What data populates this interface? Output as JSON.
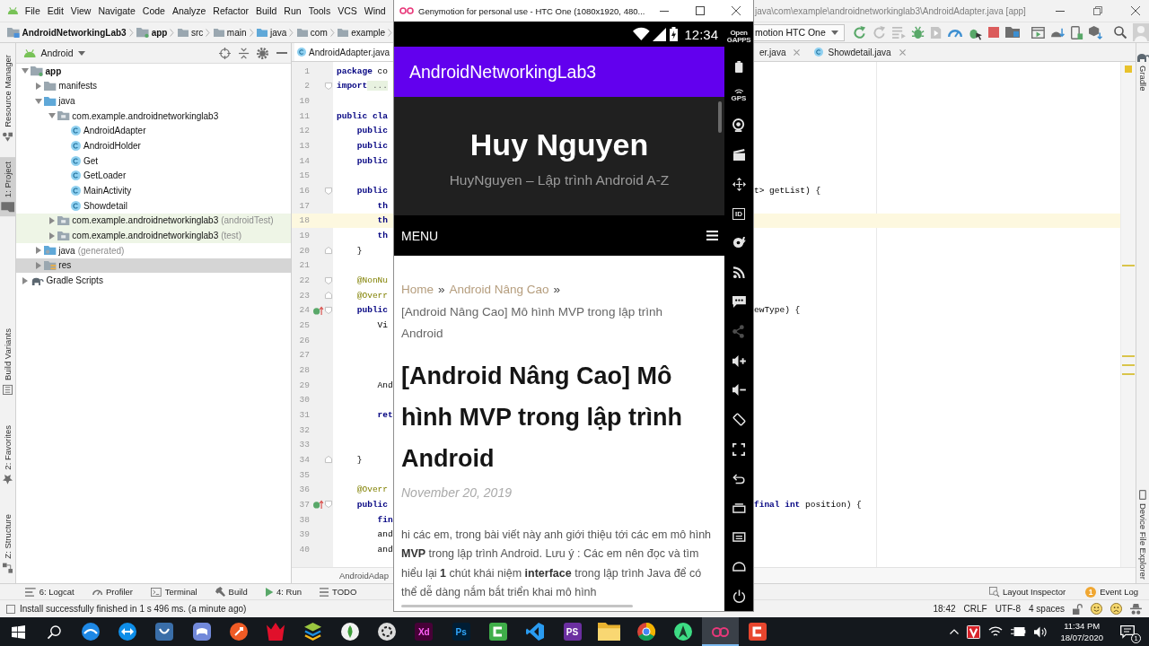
{
  "ide": {
    "menu": [
      "File",
      "Edit",
      "View",
      "Navigate",
      "Code",
      "Analyze",
      "Refactor",
      "Build",
      "Run",
      "Tools",
      "VCS",
      "Wind"
    ],
    "title": "java\\com\\example\\androidnetworkinglab3\\AndroidAdapter.java [app]",
    "breadcrumb": [
      {
        "label": "AndroidNetworkingLab3",
        "kind": "project"
      },
      {
        "label": "app",
        "kind": "module"
      },
      {
        "label": "src",
        "kind": "folder"
      },
      {
        "label": "main",
        "kind": "folder"
      },
      {
        "label": "java",
        "kind": "source"
      },
      {
        "label": "com",
        "kind": "folder"
      },
      {
        "label": "example",
        "kind": "folder"
      }
    ],
    "device": "motion HTC One",
    "left_tools_top": [
      {
        "label": "Resource Manager",
        "kind": "resources",
        "selected": false
      },
      {
        "label": "1: Project",
        "kind": "project",
        "selected": true
      }
    ],
    "left_tools_bottom": [
      {
        "label": "Build Variants",
        "kind": "variants",
        "selected": false
      },
      {
        "label": "2: Favorites",
        "kind": "favorites",
        "selected": false
      },
      {
        "label": "Z: Structure",
        "kind": "structure",
        "selected": false
      }
    ],
    "project": {
      "view": "Android",
      "tree": [
        {
          "label": "app",
          "kind": "module",
          "expanded": true,
          "selected": false,
          "children": [
            {
              "label": "manifests",
              "kind": "folder",
              "expanded": false,
              "selected": false
            },
            {
              "label": "java",
              "kind": "source",
              "expanded": true,
              "selected": false,
              "children": [
                {
                  "label": "com.example.androidnetworkinglab3",
                  "kind": "package",
                  "expanded": true,
                  "selected": false,
                  "children": [
                    {
                      "label": "AndroidAdapter",
                      "kind": "class",
                      "selected": false
                    },
                    {
                      "label": "AndroidHolder",
                      "kind": "class",
                      "selected": false
                    },
                    {
                      "label": "Get",
                      "kind": "class",
                      "selected": false
                    },
                    {
                      "label": "GetLoader",
                      "kind": "class",
                      "selected": false
                    },
                    {
                      "label": "MainActivity",
                      "kind": "class",
                      "selected": false
                    },
                    {
                      "label": "Showdetail",
                      "kind": "class",
                      "selected": false
                    }
                  ]
                },
                {
                  "label": "com.example.androidnetworkinglab3",
                  "note": "(androidTest)",
                  "kind": "test_package",
                  "expanded": false,
                  "selected": false
                },
                {
                  "label": "com.example.androidnetworkinglab3",
                  "note": "(test)",
                  "kind": "test_package",
                  "expanded": false,
                  "selected": false
                }
              ]
            },
            {
              "label": "java",
              "note": "(generated)",
              "kind": "generated",
              "expanded": false,
              "selected": false
            },
            {
              "label": "res",
              "kind": "resources",
              "expanded": false,
              "selected": true
            }
          ]
        },
        {
          "label": "Gradle Scripts",
          "kind": "gradle",
          "expanded": false,
          "selected": false
        }
      ]
    },
    "editor": {
      "tabs_left": [
        {
          "label": "AndroidAdapter.java",
          "kind": "file",
          "selected": true
        }
      ],
      "tabs_right": [
        {
          "label": "er.java",
          "kind": "cut",
          "selected": false,
          "closable": true
        },
        {
          "label": "Showdetail.java",
          "kind": "file",
          "selected": false,
          "closable": true
        }
      ],
      "lines": [
        {
          "number": "1",
          "left": [
            {
              "text": "package",
              "kind": "keyword"
            },
            {
              "text": " co",
              "kind": "plain"
            }
          ],
          "current": false,
          "override": false,
          "fold_open": false,
          "fold_close": false
        },
        {
          "number": "2",
          "left": [
            {
              "text": "import",
              "kind": "keyword"
            },
            {
              "text": " ...",
              "kind": "folded"
            }
          ],
          "current": false,
          "override": false,
          "fold_open": true,
          "fold_close": false
        },
        {
          "number": "10",
          "current": false,
          "override": false,
          "fold_open": false,
          "fold_close": false
        },
        {
          "number": "11",
          "left": [
            {
              "text": "public cla",
              "kind": "keyword"
            }
          ],
          "current": false,
          "override": false,
          "fold_open": false,
          "fold_close": false
        },
        {
          "number": "12",
          "left": [
            {
              "text": "    public",
              "kind": "keyword"
            }
          ],
          "current": false,
          "override": false,
          "fold_open": false,
          "fold_close": false
        },
        {
          "number": "13",
          "left": [
            {
              "text": "    public",
              "kind": "keyword"
            }
          ],
          "current": false,
          "override": false,
          "fold_open": false,
          "fold_close": false
        },
        {
          "number": "14",
          "left": [
            {
              "text": "    public",
              "kind": "keyword"
            }
          ],
          "current": false,
          "override": false,
          "fold_open": false,
          "fold_close": false
        },
        {
          "number": "15",
          "current": false,
          "override": false,
          "fold_open": false,
          "fold_close": false
        },
        {
          "number": "16",
          "left": [
            {
              "text": "    public",
              "kind": "keyword"
            }
          ],
          "right": [
            {
              "text": "t> getList) {",
              "kind": "plain"
            }
          ],
          "current": false,
          "override": false,
          "fold_open": true,
          "fold_close": false
        },
        {
          "number": "17",
          "left": [
            {
              "text": "        th",
              "kind": "keyword"
            }
          ],
          "current": false,
          "override": false,
          "fold_open": false,
          "fold_close": false
        },
        {
          "number": "18",
          "left": [
            {
              "text": "        th",
              "kind": "keyword"
            }
          ],
          "current": true,
          "override": false,
          "fold_open": false,
          "fold_close": false
        },
        {
          "number": "19",
          "left": [
            {
              "text": "        th",
              "kind": "keyword"
            }
          ],
          "current": false,
          "override": false,
          "fold_open": false,
          "fold_close": false
        },
        {
          "number": "20",
          "left": [
            {
              "text": "    }",
              "kind": "plain"
            }
          ],
          "current": false,
          "override": false,
          "fold_open": false,
          "fold_close": true
        },
        {
          "number": "21",
          "current": false,
          "override": false,
          "fold_open": false,
          "fold_close": false
        },
        {
          "number": "22",
          "left": [
            {
              "text": "    @NonNu",
              "kind": "annotation"
            }
          ],
          "current": false,
          "override": false,
          "fold_open": true,
          "fold_close": false
        },
        {
          "number": "23",
          "left": [
            {
              "text": "    @Overr",
              "kind": "annotation"
            }
          ],
          "current": false,
          "override": false,
          "fold_open": false,
          "fold_close": true
        },
        {
          "number": "24",
          "left": [
            {
              "text": "    public",
              "kind": "keyword"
            }
          ],
          "right": [
            {
              "text": "ewType) {",
              "kind": "plain"
            }
          ],
          "current": false,
          "override": true,
          "fold_open": true,
          "fold_close": false
        },
        {
          "number": "25",
          "left": [
            {
              "text": "        Vi",
              "kind": "plain"
            }
          ],
          "current": false,
          "override": false,
          "fold_open": false,
          "fold_close": false
        },
        {
          "number": "26",
          "current": false,
          "override": false,
          "fold_open": false,
          "fold_close": false
        },
        {
          "number": "27",
          "current": false,
          "override": false,
          "fold_open": false,
          "fold_close": false
        },
        {
          "number": "28",
          "current": false,
          "override": false,
          "fold_open": false,
          "fold_close": false
        },
        {
          "number": "29",
          "left": [
            {
              "text": "        And",
              "kind": "plain"
            }
          ],
          "current": false,
          "override": false,
          "fold_open": false,
          "fold_close": false
        },
        {
          "number": "30",
          "current": false,
          "override": false,
          "fold_open": false,
          "fold_close": false
        },
        {
          "number": "31",
          "left": [
            {
              "text": "        ret",
              "kind": "keyword"
            }
          ],
          "current": false,
          "override": false,
          "fold_open": false,
          "fold_close": false
        },
        {
          "number": "32",
          "current": false,
          "override": false,
          "fold_open": false,
          "fold_close": false
        },
        {
          "number": "33",
          "current": false,
          "override": false,
          "fold_open": false,
          "fold_close": false
        },
        {
          "number": "34",
          "left": [
            {
              "text": "    }",
              "kind": "plain"
            }
          ],
          "current": false,
          "override": false,
          "fold_open": false,
          "fold_close": true
        },
        {
          "number": "35",
          "current": false,
          "override": false,
          "fold_open": false,
          "fold_close": false
        },
        {
          "number": "36",
          "left": [
            {
              "text": "    @Overr",
              "kind": "annotation"
            }
          ],
          "current": false,
          "override": false,
          "fold_open": false,
          "fold_close": false
        },
        {
          "number": "37",
          "left": [
            {
              "text": "    public",
              "kind": "keyword"
            }
          ],
          "right": [
            {
              "text": "final",
              "kind": "keyword"
            },
            {
              "text": " int",
              "kind": "keyword"
            },
            {
              "text": " position) {",
              "kind": "plain"
            }
          ],
          "current": false,
          "override": true,
          "fold_open": true,
          "fold_close": false
        },
        {
          "number": "38",
          "left": [
            {
              "text": "        fin",
              "kind": "keyword"
            }
          ],
          "current": false,
          "override": false,
          "fold_open": false,
          "fold_close": false
        },
        {
          "number": "39",
          "left": [
            {
              "text": "        and",
              "kind": "plain"
            }
          ],
          "current": false,
          "override": false,
          "fold_open": false,
          "fold_close": false
        },
        {
          "number": "40",
          "left": [
            {
              "text": "        and",
              "kind": "plain"
            }
          ],
          "current": false,
          "override": false,
          "fold_open": false,
          "fold_close": false
        }
      ],
      "footer": "AndroidAdap"
    },
    "right_tools_top": [
      {
        "label": "Gradle",
        "kind": "gradle"
      }
    ],
    "right_tools_bottom": [
      {
        "label": "Device File Explorer",
        "kind": "device"
      }
    ],
    "tool_tabs": [
      {
        "label": "6: Logcat",
        "kind": "logcat"
      },
      {
        "label": "Profiler",
        "kind": "profiler"
      },
      {
        "label": "Terminal",
        "kind": "terminal"
      },
      {
        "label": "Build",
        "kind": "build"
      },
      {
        "label": "4: Run",
        "kind": "run"
      },
      {
        "label": "TODO",
        "kind": "todo"
      }
    ],
    "tool_tabs_right": [
      {
        "label": "Layout Inspector",
        "kind": "inspector"
      },
      {
        "label": "Event Log",
        "kind": "log",
        "badge": "1"
      }
    ],
    "status": {
      "message": "Install successfully finished in 1 s 496 ms. (a minute ago)",
      "fields": [
        "18:42",
        "CRLF",
        "UTF-8",
        "4 spaces"
      ]
    }
  },
  "emulator": {
    "title": "Genymotion for personal use - HTC One (1080x1920, 480...",
    "clock": "12:34",
    "app_title": "AndroidNetworkingLab3",
    "site": {
      "name": "Huy Nguyen",
      "tagline": "HuyNguyen – Lập trình Android A-Z",
      "menu": "MENU",
      "breadcrumb": [
        {
          "kind": "link",
          "label": "Home"
        },
        {
          "kind": "separator",
          "label": "»"
        },
        {
          "kind": "link",
          "label": "Android Nâng Cao"
        },
        {
          "kind": "separator",
          "label": "»"
        },
        {
          "kind": "current",
          "label": "[Android Nâng Cao] Mô hình MVP trong lập trình Android"
        }
      ],
      "heading": "[Android Nâng Cao] Mô hình MVP trong lập trình Android",
      "date": "November 20, 2019",
      "intro": "hi các em, trong bài viết này anh giới thiệu tới các em mô hình **MVP** trong lập trình Android. Lưu ý : Các em nên đọc và tìm hiểu lại **1** chút khái niệm **interface** trong lập trình Java để có thể dễ dàng nắm bắt triển khai mô hình"
    },
    "toolbar": [
      {
        "kind": "gapps",
        "label": "Open GAPPS",
        "disabled": false
      },
      {
        "kind": "battery",
        "disabled": false
      },
      {
        "kind": "gps",
        "label": "GPS",
        "disabled": false
      },
      {
        "kind": "webcam",
        "disabled": false
      },
      {
        "kind": "capture",
        "disabled": false
      },
      {
        "kind": "dpad",
        "disabled": false
      },
      {
        "kind": "id",
        "label": "ID",
        "disabled": false
      },
      {
        "kind": "disc",
        "disabled": false
      },
      {
        "kind": "network",
        "disabled": false
      },
      {
        "kind": "sms",
        "disabled": false
      },
      {
        "kind": "share",
        "disabled": true
      },
      {
        "kind": "volume_up",
        "disabled": false
      },
      {
        "kind": "volume_down",
        "disabled": false
      },
      {
        "kind": "rotate",
        "disabled": false
      },
      {
        "kind": "scale",
        "disabled": false
      },
      {
        "kind": "back",
        "disabled": false
      },
      {
        "kind": "recent",
        "disabled": false
      },
      {
        "kind": "menu",
        "disabled": false
      },
      {
        "kind": "home",
        "disabled": false
      },
      {
        "kind": "power",
        "disabled": false
      }
    ]
  },
  "taskbar": {
    "apps": [
      {
        "kind": "globe",
        "selected": false
      },
      {
        "kind": "arrows",
        "selected": false
      },
      {
        "kind": "tile",
        "selected": false
      },
      {
        "kind": "gamepad",
        "selected": false
      },
      {
        "kind": "orbit",
        "selected": false
      },
      {
        "kind": "claw",
        "selected": false
      },
      {
        "kind": "layers",
        "selected": false
      },
      {
        "kind": "leaf",
        "selected": false
      },
      {
        "kind": "aperture",
        "selected": false
      },
      {
        "kind": "xd",
        "label": "Xd",
        "selected": false
      },
      {
        "kind": "ps",
        "label": "Ps",
        "selected": false
      },
      {
        "kind": "bracket",
        "selected": false
      },
      {
        "kind": "ribbon",
        "selected": false
      },
      {
        "kind": "phpstorm",
        "label": "PS",
        "selected": false
      },
      {
        "kind": "folder",
        "selected": false
      },
      {
        "kind": "pinwheel",
        "selected": false
      },
      {
        "kind": "compass",
        "selected": false
      },
      {
        "kind": "rings",
        "selected": true
      },
      {
        "kind": "bracket_red",
        "selected": false
      }
    ],
    "time": "11:34 PM",
    "date": "18/07/2020",
    "notifications": "1"
  }
}
